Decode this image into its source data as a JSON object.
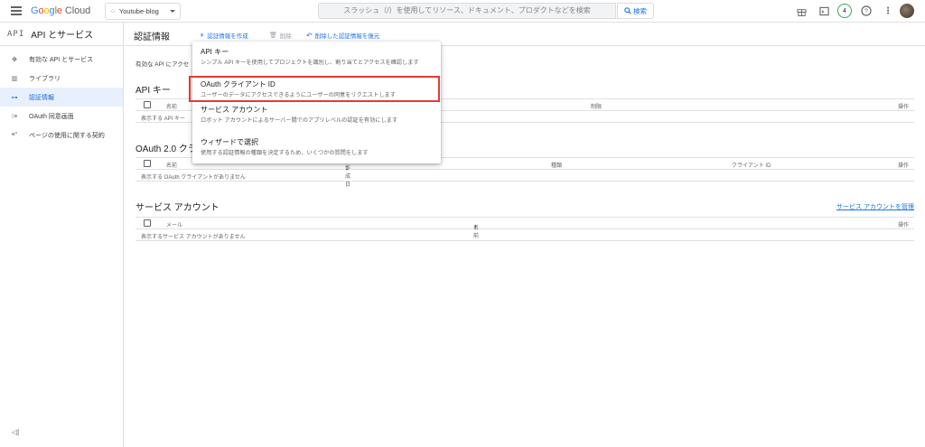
{
  "topbar": {
    "logo_google": "Google",
    "logo_cloud": "Cloud",
    "project_name": "Youtube-blog",
    "search_placeholder": "スラッシュ（/）を使用してリソース、ドキュメント、プロダクトなどを検索",
    "search_button": "検索",
    "notification_count": "4"
  },
  "sidebar": {
    "logo_text": "API",
    "title": "API とサービス",
    "items": [
      {
        "label": "有効な API とサービス",
        "icon": "api-diamond-icon",
        "active": false
      },
      {
        "label": "ライブラリ",
        "icon": "library-icon",
        "active": false
      },
      {
        "label": "認証情報",
        "icon": "key-icon",
        "active": true
      },
      {
        "label": "OAuth 同意画面",
        "icon": "consent-icon",
        "active": false
      },
      {
        "label": "ページの使用に関する契約",
        "icon": "settings-icon",
        "active": false
      }
    ],
    "collapse_label": "◁|"
  },
  "actionbar": {
    "page_title": "認証情報",
    "create_label": "認証情報を作成",
    "delete_label": "削除",
    "restore_label": "削除した認証情報を復元"
  },
  "main": {
    "intro_text": "有効な API にアクセ",
    "api_keys": {
      "title": "API キー",
      "col_name": "名前",
      "col_restriction": "制限",
      "col_action": "操作",
      "empty": "表示する API キー"
    },
    "oauth": {
      "title": "OAuth 2.0 クラ",
      "col_name": "名前",
      "col_created": "作成日",
      "col_type": "種類",
      "col_client_id": "クライアント ID",
      "col_action": "操作",
      "empty": "表示する OAuth クライアントがありません"
    },
    "service_accounts": {
      "title": "サービス アカウント",
      "manage_link": "サービス アカウントを管理",
      "col_mail": "メール",
      "col_name": "名前",
      "col_action": "操作",
      "empty": "表示するサービス アカウントがありません"
    }
  },
  "dropdown": {
    "items": [
      {
        "title": "API キー",
        "desc": "シンプル API キーを使用してプロジェクトを識別し、割り当てとアクセスを確認します"
      },
      {
        "title": "OAuth クライアント ID",
        "desc": "ユーザーのデータにアクセスできるようにユーザーの同意をリクエストします"
      },
      {
        "title": "サービス アカウント",
        "desc": "ロボット アカウントによるサーバー間でのアプリレベルの認証を有効にします"
      },
      {
        "title": "ウィザードで選択",
        "desc": "使用する認証情報の種類を決定するため、いくつかの質問をします"
      }
    ]
  },
  "colors": {
    "accent": "#1a73e8",
    "active_bg": "#e8f0fe",
    "highlight_border": "#e53935"
  }
}
